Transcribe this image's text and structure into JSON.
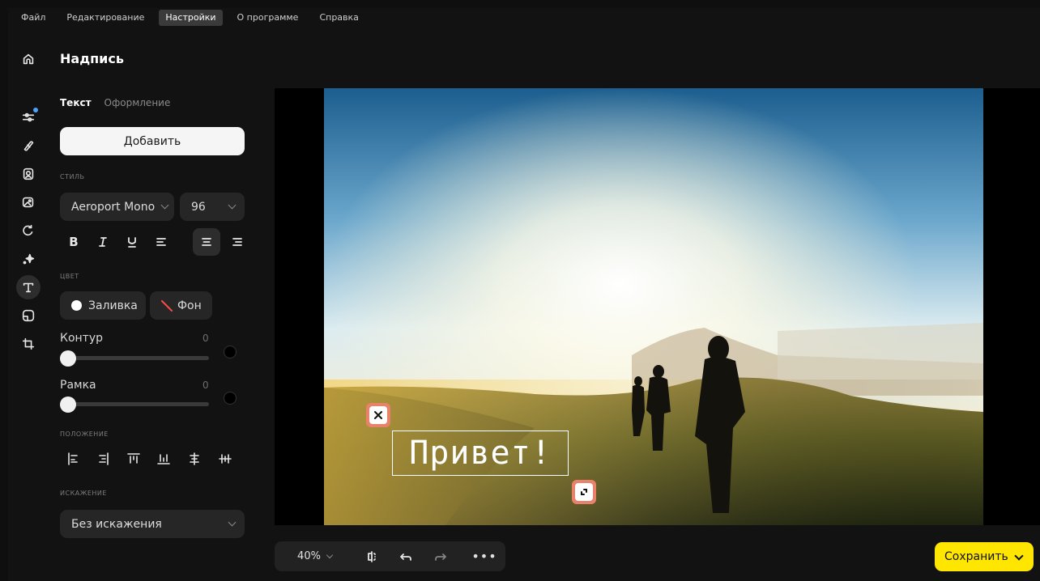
{
  "menu": [
    {
      "label": "Файл",
      "active": false
    },
    {
      "label": "Редактирование",
      "active": false
    },
    {
      "label": "Настройки",
      "active": true
    },
    {
      "label": "О программе",
      "active": false
    },
    {
      "label": "Справка",
      "active": false
    }
  ],
  "rail": {
    "items": [
      "home-icon",
      "adjust-icon",
      "eraser-icon",
      "portrait-icon",
      "image-edit-icon",
      "rotate-icon",
      "sparkle-icon",
      "text-icon",
      "frame-icon",
      "crop-icon"
    ],
    "active": "text-icon"
  },
  "panel": {
    "title": "Надпись",
    "tabs": [
      {
        "label": "Текст",
        "active": true
      },
      {
        "label": "Оформление",
        "active": false
      }
    ],
    "add_label": "Добавить",
    "style_section": "стиль",
    "font": "Aeroport Mono",
    "size": "96",
    "format_buttons": [
      "bold",
      "italic",
      "underline",
      "align-left",
      "align-center",
      "align-right"
    ],
    "active_format": "align-center",
    "color_section": "цвет",
    "fill_label": "Заливка",
    "bg_label": "Фон",
    "contour_label": "Контур",
    "contour_value": "0",
    "frame_label": "Рамка",
    "frame_value": "0",
    "position_section": "положение",
    "distortion_section": "искажение",
    "distortion_value": "Без искажения"
  },
  "canvas": {
    "overlay_text": "Привет!"
  },
  "bottom": {
    "zoom": "40%",
    "save_label": "Сохранить"
  },
  "colors": {
    "accent_save": "#ffe600",
    "handle": "#e8826a",
    "badge": "#4aa3ff"
  }
}
